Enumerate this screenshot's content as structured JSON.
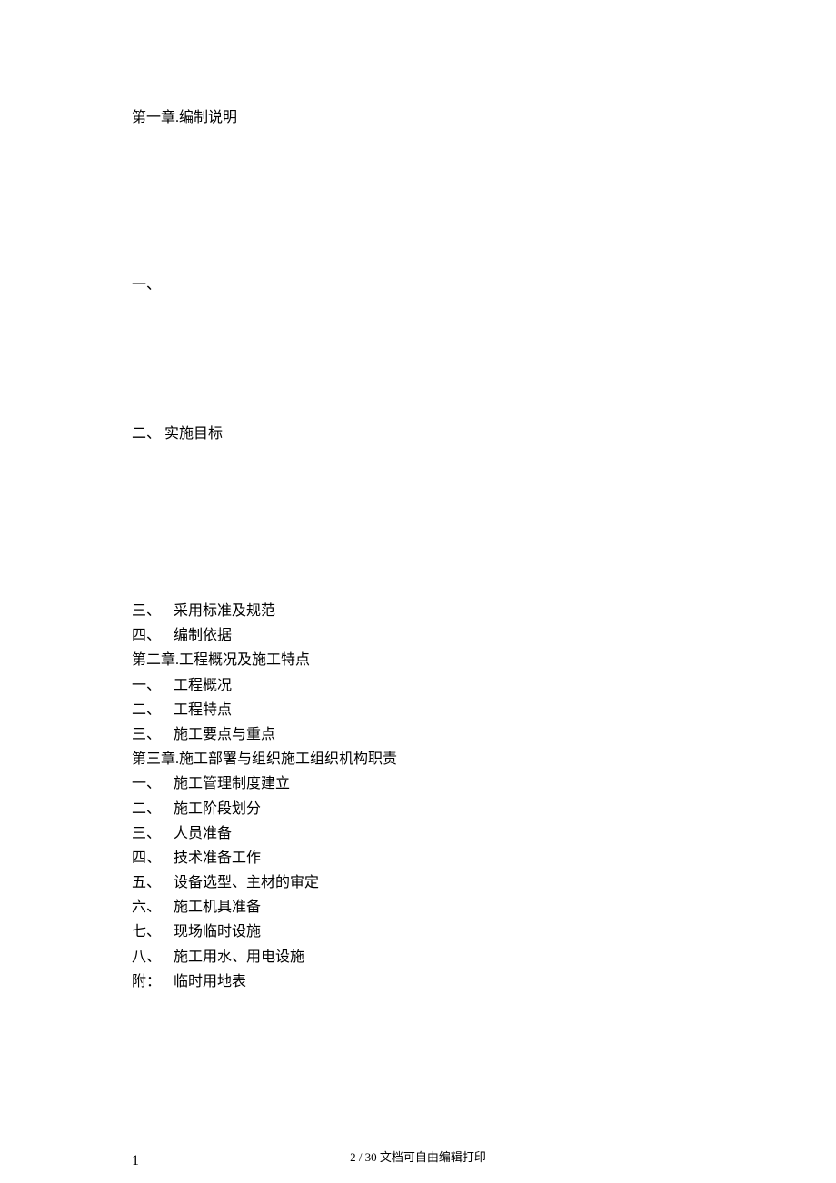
{
  "chapter1": {
    "title": "第一章.编制说明"
  },
  "section1": {
    "marker": "一、"
  },
  "section2": {
    "marker": "二、",
    "title": "实施目标"
  },
  "toc": [
    {
      "label": "三、",
      "text": "采用标准及规范",
      "indented": true
    },
    {
      "label": "四、",
      "text": "编制依据",
      "indented": true
    },
    {
      "label": "",
      "text": "第二章.工程概况及施工特点",
      "indented": false
    },
    {
      "label": "一、",
      "text": "工程概况",
      "indented": true
    },
    {
      "label": "二、",
      "text": "工程特点",
      "indented": true
    },
    {
      "label": "三、",
      "text": "施工要点与重点",
      "indented": true
    },
    {
      "label": "",
      "text": "第三章.施工部署与组织施工组织机构职责",
      "indented": false
    },
    {
      "label": "一、",
      "text": "施工管理制度建立",
      "indented": true
    },
    {
      "label": "二、",
      "text": "施工阶段划分",
      "indented": true
    },
    {
      "label": "三、",
      "text": "人员准备",
      "indented": true
    },
    {
      "label": "四、",
      "text": "技术准备工作",
      "indented": true
    },
    {
      "label": "五、",
      "text": "设备选型、主材的审定",
      "indented": true
    },
    {
      "label": "六、",
      "text": "施工机具准备",
      "indented": true
    },
    {
      "label": "七、",
      "text": "现场临时设施",
      "indented": true
    },
    {
      "label": "八、",
      "text": "施工用水、用电设施",
      "indented": true
    },
    {
      "label": "附：",
      "text": "临时用地表",
      "indented": true
    }
  ],
  "pageNumberBody": "1",
  "footer": {
    "text": "2 / 30 文档可自由编辑打印"
  }
}
